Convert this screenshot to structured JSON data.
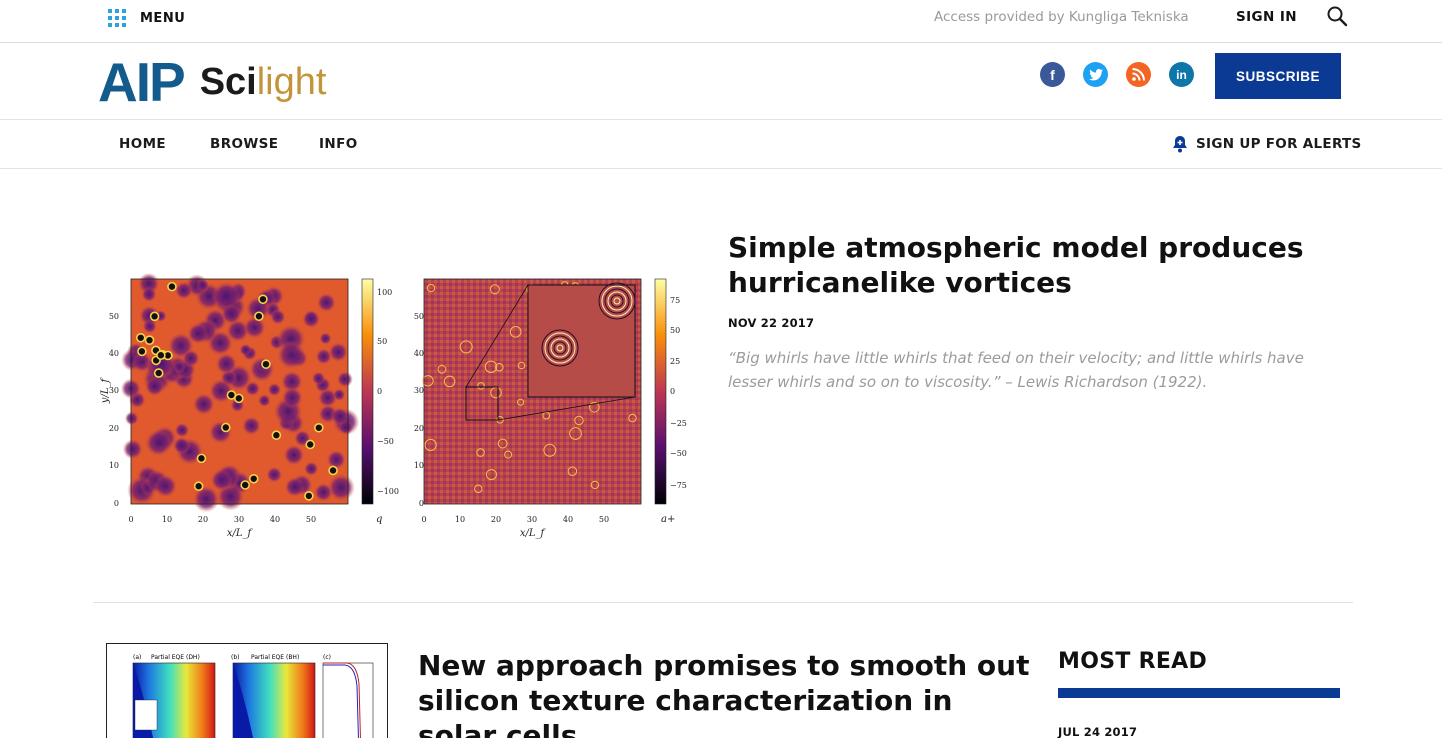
{
  "topbar": {
    "menu_label": "MENU",
    "access_text": "Access provided by Kungliga Tekniska",
    "signin_label": "SIGN IN"
  },
  "brand": {
    "logo_aip": "AIP",
    "logo_sci": "Sci",
    "logo_light": "light",
    "subscribe_label": "SUBSCRIBE",
    "social": [
      {
        "name": "facebook",
        "glyph": "f"
      },
      {
        "name": "twitter",
        "glyph": "t"
      },
      {
        "name": "rss",
        "glyph": "))"
      },
      {
        "name": "linkedin",
        "glyph": "in"
      }
    ],
    "colors": {
      "aip_blue": "#125b8c",
      "light_gold": "#c3953a",
      "subscribe_bg": "#0b3a94"
    }
  },
  "nav": {
    "items": [
      "HOME",
      "BROWSE",
      "INFO"
    ],
    "alerts_label": "SIGN UP FOR ALERTS"
  },
  "featured": {
    "title": "Simple atmospheric model produces hurricanelike vortices",
    "date": "NOV 22 2017",
    "quote": "“Big whirls have little whirls that feed on their velocity; and little whirls have lesser whirls and so on to viscosity.” – Lewis Richardson (1922).",
    "figure": {
      "left_yticks": [
        "50",
        "40",
        "30",
        "20",
        "10",
        "0"
      ],
      "left_xticks": [
        "0",
        "10",
        "20",
        "30",
        "40",
        "50"
      ],
      "left_ylabel": "y/L_f",
      "left_xlabel": "x/L_f",
      "left_cbar_ticks": [
        "100",
        "50",
        "0",
        "−50",
        "−100"
      ],
      "left_cbar_label": "q",
      "right_yticks": [
        "50",
        "40",
        "30",
        "20",
        "10",
        "0"
      ],
      "right_xticks": [
        "0",
        "10",
        "20",
        "30",
        "40",
        "50"
      ],
      "right_xlabel": "x/L_f",
      "right_cbar_ticks": [
        "75",
        "50",
        "25",
        "0",
        "−25",
        "−50",
        "−75"
      ],
      "right_cbar_label": "a+"
    }
  },
  "second": {
    "title": "New approach promises to smooth out silicon texture characterization in solar cells",
    "figure_labels": [
      "(a)",
      "Partial EQE (DH)",
      "(b)",
      "Partial EQE (BH)",
      "(c)"
    ]
  },
  "most_read": {
    "heading": "MOST READ",
    "first_date": "JUL 24 2017"
  }
}
